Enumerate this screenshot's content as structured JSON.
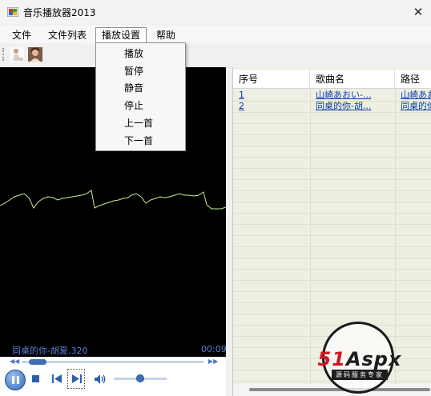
{
  "window": {
    "title": "音乐播放器2013",
    "close_glyph": "✕"
  },
  "menubar": {
    "items": [
      {
        "label": "文件"
      },
      {
        "label": "文件列表"
      },
      {
        "label": "播放设置"
      },
      {
        "label": "帮助"
      }
    ],
    "open_menu": "播放设置"
  },
  "dropdown": {
    "items": [
      {
        "label": "播放"
      },
      {
        "label": "暂停"
      },
      {
        "label": "静音"
      },
      {
        "label": "停止"
      },
      {
        "label": "上一首"
      },
      {
        "label": "下一首"
      }
    ]
  },
  "toolbar": {
    "icons": [
      "person-icon",
      "photo-icon"
    ]
  },
  "player": {
    "now_playing": "同桌的你-胡夏.320",
    "time": "00:09",
    "seek_progress": 0.04,
    "volume_level": 0.5
  },
  "playlist": {
    "columns": [
      {
        "label": "序号"
      },
      {
        "label": "歌曲名"
      },
      {
        "label": "路径"
      }
    ],
    "rows": [
      {
        "index": "1",
        "name": "山崎あおい-...",
        "path": "山崎あお"
      },
      {
        "index": "2",
        "name": "同桌的你-胡...",
        "path": "同桌的你"
      }
    ]
  },
  "watermark": {
    "logo_a": "51",
    "logo_b": "Aspx",
    "subtitle": "源码服务专家"
  },
  "colors": {
    "visualizer_bg": "#000000",
    "wave": "#c8f08c",
    "now_playing_text": "#5a7fd8",
    "link_text": "#0b3aa8",
    "list_bg": "#ecefe2"
  }
}
